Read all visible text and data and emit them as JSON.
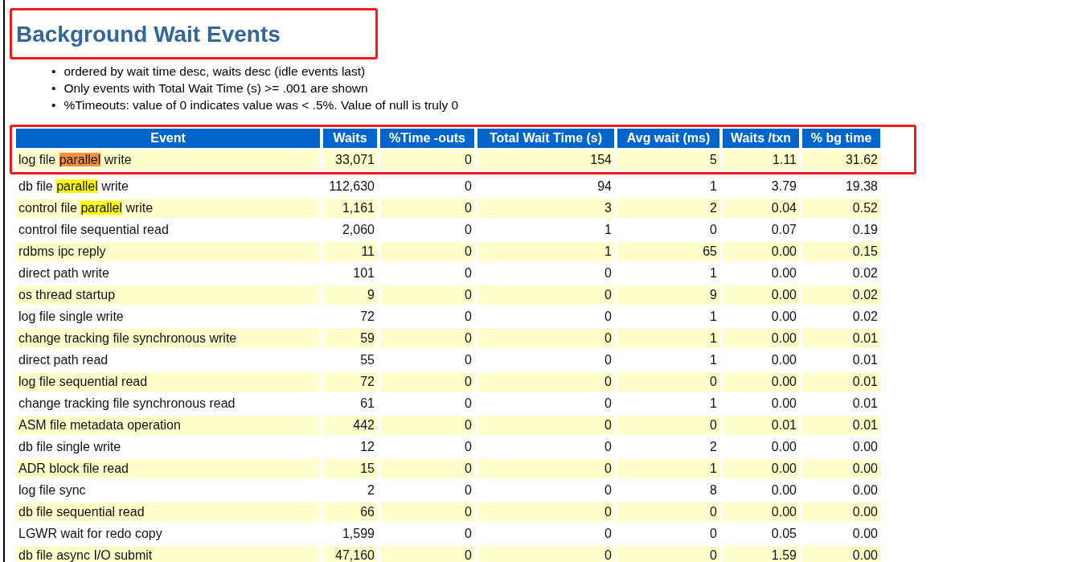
{
  "heading": {
    "text": "Background Wait Events",
    "framed": true
  },
  "notes": [
    {
      "bullet": "•",
      "text": "ordered by wait time desc, waits desc (idle events last)"
    },
    {
      "bullet": "•",
      "text": "Only events with Total Wait Time (s) >= .001 are shown"
    },
    {
      "bullet": "•",
      "text": "%Timeouts: value of 0 indicates value was < .5%. Value of null is truly 0"
    }
  ],
  "table": {
    "framed_header": true,
    "columns": [
      "Event",
      "Waits",
      "%Time -outs",
      "Total Wait Time (s)",
      "Avg wait (ms)",
      "Waits /txn",
      "% bg time"
    ],
    "rows": [
      {
        "framed": true,
        "cells": [
          {
            "before": "log file ",
            "mark": "parallel",
            "after": " write",
            "color": "#f5923e"
          },
          "33,071",
          "0",
          "154",
          "5",
          "1.11",
          "31.62"
        ]
      },
      {
        "framed": false,
        "cells": [
          {
            "before": "db file ",
            "mark": "parallel",
            "after": " write",
            "color": "#ffff00"
          },
          "112,630",
          "0",
          "94",
          "1",
          "3.79",
          "19.38"
        ]
      },
      {
        "framed": false,
        "cells": [
          {
            "before": "control file ",
            "mark": "parallel",
            "after": " write",
            "color": "#ffff00"
          },
          "1,161",
          "0",
          "3",
          "2",
          "0.04",
          "0.52"
        ]
      },
      {
        "framed": false,
        "cells": [
          "control file sequential read",
          "2,060",
          "0",
          "1",
          "0",
          "0.07",
          "0.19"
        ]
      },
      {
        "framed": false,
        "cells": [
          "rdbms ipc reply",
          "11",
          "0",
          "1",
          "65",
          "0.00",
          "0.15"
        ]
      },
      {
        "framed": false,
        "cells": [
          "direct path write",
          "101",
          "0",
          "0",
          "1",
          "0.00",
          "0.02"
        ]
      },
      {
        "framed": false,
        "cells": [
          "os thread startup",
          "9",
          "0",
          "0",
          "9",
          "0.00",
          "0.02"
        ]
      },
      {
        "framed": false,
        "cells": [
          "log file single write",
          "72",
          "0",
          "0",
          "1",
          "0.00",
          "0.02"
        ]
      },
      {
        "framed": false,
        "cells": [
          "change tracking file synchronous write",
          "59",
          "0",
          "0",
          "1",
          "0.00",
          "0.01"
        ]
      },
      {
        "framed": false,
        "cells": [
          "direct path read",
          "55",
          "0",
          "0",
          "1",
          "0.00",
          "0.01"
        ]
      },
      {
        "framed": false,
        "cells": [
          "log file sequential read",
          "72",
          "0",
          "0",
          "0",
          "0.00",
          "0.01"
        ]
      },
      {
        "framed": false,
        "cells": [
          "change tracking file synchronous read",
          "61",
          "0",
          "0",
          "1",
          "0.00",
          "0.01"
        ]
      },
      {
        "framed": false,
        "cells": [
          "ASM file metadata operation",
          "442",
          "0",
          "0",
          "0",
          "0.01",
          "0.01"
        ]
      },
      {
        "framed": false,
        "cells": [
          "db file single write",
          "12",
          "0",
          "0",
          "2",
          "0.00",
          "0.00"
        ]
      },
      {
        "framed": false,
        "cells": [
          "ADR block file read",
          "15",
          "0",
          "0",
          "1",
          "0.00",
          "0.00"
        ]
      },
      {
        "framed": false,
        "cells": [
          "log file sync",
          "2",
          "0",
          "0",
          "8",
          "0.00",
          "0.00"
        ]
      },
      {
        "framed": false,
        "cells": [
          "db file sequential read",
          "66",
          "0",
          "0",
          "0",
          "0.00",
          "0.00"
        ]
      },
      {
        "framed": false,
        "cells": [
          "LGWR wait for redo copy",
          "1,599",
          "0",
          "0",
          "0",
          "0.05",
          "0.00"
        ]
      },
      {
        "framed": false,
        "cells": [
          "db file async I/O submit",
          "47,160",
          "0",
          "0",
          "0",
          "1.59",
          "0.00"
        ]
      }
    ]
  }
}
